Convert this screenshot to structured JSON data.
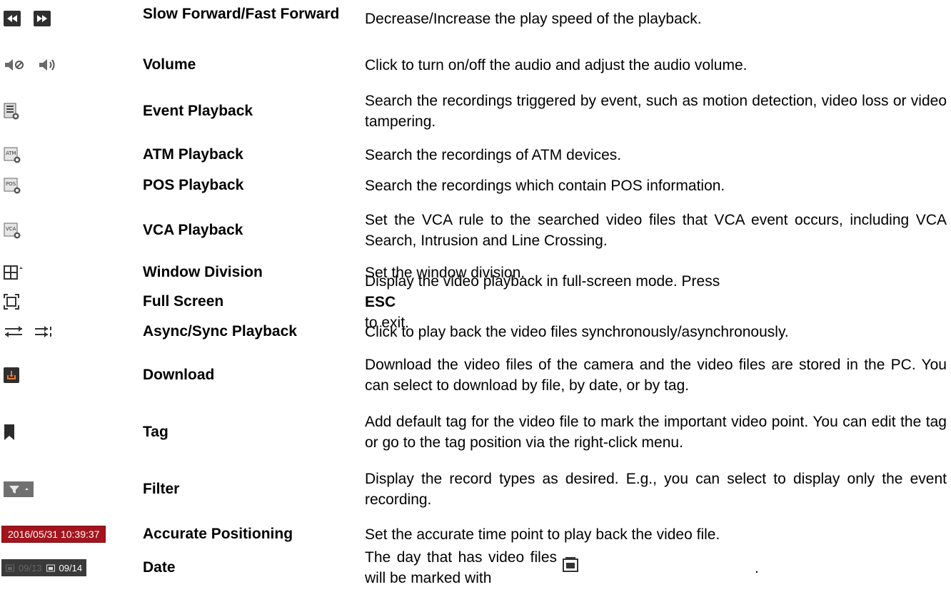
{
  "rows": [
    {
      "name": "Slow Forward/Fast Forward",
      "desc": "Decrease/Increase the play speed of the playback.",
      "icons": [
        "slow-forward-icon",
        "fast-forward-icon"
      ]
    },
    {
      "name": "Volume",
      "desc": "Click to turn on/off the audio and adjust the audio volume.",
      "icons": [
        "mute-icon",
        "volume-icon"
      ]
    },
    {
      "name": "Event Playback",
      "desc": "Search the recordings triggered by event, such as motion detection, video loss or video tampering.",
      "icons": [
        "event-playback-icon"
      ]
    },
    {
      "name": "ATM Playback",
      "desc": "Search the recordings of ATM devices.",
      "icons": [
        "atm-playback-icon"
      ],
      "icon_text": "ATM"
    },
    {
      "name": "POS Playback",
      "desc": "Search the recordings which contain POS information.",
      "icons": [
        "pos-playback-icon"
      ],
      "icon_text": "POS"
    },
    {
      "name": "VCA Playback",
      "desc": "Set the VCA rule to the searched video files that VCA event occurs, including VCA Search, Intrusion and Line Crossing.",
      "icons": [
        "vca-playback-icon"
      ],
      "icon_text": "VCA"
    },
    {
      "name": "Window Division",
      "desc": "Set the window division.",
      "icons": [
        "window-division-icon"
      ]
    },
    {
      "name": "Full Screen",
      "desc_before": "Display the video playback in full-screen mode. Press ",
      "desc_bold": "ESC",
      "desc_after": " to exit.",
      "icons": [
        "full-screen-icon"
      ]
    },
    {
      "name": "Async/Sync Playback",
      "desc": "Click to play back the video files synchronously/asynchronously.",
      "icons": [
        "async-playback-icon",
        "sync-playback-icon"
      ]
    },
    {
      "name": "Download",
      "desc": "Download the video files of the camera and the video files are stored in the PC. You can select to download by file, by date, or by tag.",
      "icons": [
        "download-icon"
      ]
    },
    {
      "name": "Tag",
      "desc": "Add default tag for the video file to mark the important video point. You can edit the tag or go to the tag position via the right-click menu.",
      "icons": [
        "tag-icon"
      ]
    },
    {
      "name": "Filter",
      "desc": "Display the record types as desired. E.g., you can select to display only the event recording.",
      "icons": [
        "filter-icon"
      ]
    },
    {
      "name": "Accurate Positioning",
      "desc": "Set the accurate time point to play back the video file.",
      "icons": [
        "accurate-positioning-box"
      ],
      "icon_text": "2016/05/31 10:39:37"
    },
    {
      "name": "Date",
      "desc": "The day that has video files will be marked with",
      "icons": [
        "date-bar",
        "video-file-marker-icon"
      ],
      "date_off": "09/13",
      "date_on": "09/14",
      "desc_end": "."
    }
  ]
}
